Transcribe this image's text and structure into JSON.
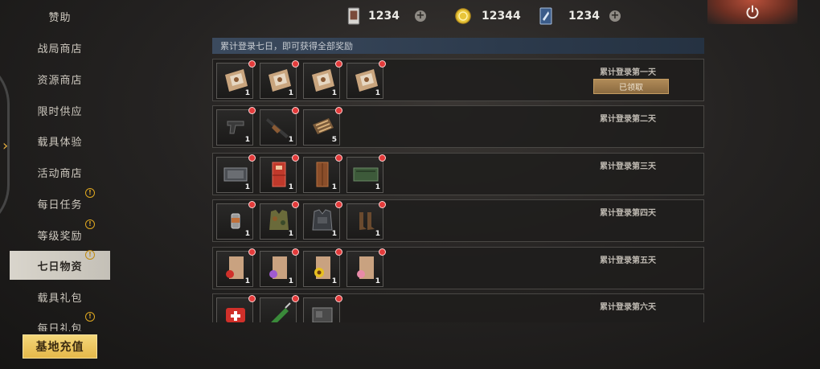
{
  "sidebar": {
    "items": [
      {
        "label": "赞助",
        "badge": false,
        "active": false
      },
      {
        "label": "战局商店",
        "badge": false,
        "active": false
      },
      {
        "label": "资源商店",
        "badge": false,
        "active": false
      },
      {
        "label": "限时供应",
        "badge": false,
        "active": false
      },
      {
        "label": "载具体验",
        "badge": false,
        "active": false
      },
      {
        "label": "活动商店",
        "badge": false,
        "active": false
      },
      {
        "label": "每日任务",
        "badge": true,
        "active": false
      },
      {
        "label": "等级奖励",
        "badge": true,
        "active": false
      },
      {
        "label": "七日物资",
        "badge": true,
        "active": true
      },
      {
        "label": "载具礼包",
        "badge": false,
        "active": false
      },
      {
        "label": "每日礼包",
        "badge": true,
        "active": false
      }
    ],
    "badge_glyph": "!",
    "recharge_label": "基地充值"
  },
  "currency": {
    "card": {
      "value": "1234",
      "icon": "card-icon"
    },
    "coin": {
      "value": "12344",
      "icon": "coin-icon"
    },
    "ticket": {
      "value": "1234",
      "icon": "ticket-icon"
    },
    "plus_glyph": "+"
  },
  "banner_text": "累计登录七日，即可获得全部奖励",
  "claimed_label": "已领取",
  "rewards": [
    {
      "day_label": "累计登录第一天",
      "claimed": true,
      "items": [
        {
          "icon": "supply-bag",
          "count": "1"
        },
        {
          "icon": "supply-bag",
          "count": "1"
        },
        {
          "icon": "supply-bag",
          "count": "1"
        },
        {
          "icon": "supply-bag",
          "count": "1"
        }
      ]
    },
    {
      "day_label": "累计登录第二天",
      "claimed": false,
      "items": [
        {
          "icon": "pistol",
          "count": "1"
        },
        {
          "icon": "rifle",
          "count": "1"
        },
        {
          "icon": "ammo",
          "count": "5"
        }
      ]
    },
    {
      "day_label": "累计登录第三天",
      "claimed": false,
      "items": [
        {
          "icon": "crate-gray",
          "count": "1"
        },
        {
          "icon": "fridge-red",
          "count": "1"
        },
        {
          "icon": "cabinet",
          "count": "1"
        },
        {
          "icon": "crate-green",
          "count": "1"
        }
      ]
    },
    {
      "day_label": "累计登录第四天",
      "claimed": false,
      "items": [
        {
          "icon": "jar",
          "count": "1"
        },
        {
          "icon": "camo-vest",
          "count": "1"
        },
        {
          "icon": "armor-vest",
          "count": "1"
        },
        {
          "icon": "boots",
          "count": "1"
        }
      ]
    },
    {
      "day_label": "累计登录第五天",
      "claimed": false,
      "items": [
        {
          "icon": "seed-red",
          "count": "1"
        },
        {
          "icon": "seed-purple",
          "count": "1"
        },
        {
          "icon": "seed-sunflower",
          "count": "1"
        },
        {
          "icon": "seed-pink",
          "count": "1"
        }
      ]
    },
    {
      "day_label": "累计登录第六天",
      "claimed": false,
      "items": [
        {
          "icon": "medkit",
          "count": ""
        },
        {
          "icon": "syringe",
          "count": ""
        },
        {
          "icon": "machine-part",
          "count": ""
        }
      ]
    }
  ],
  "colors": {
    "accent": "#e5b84a",
    "active_tab": "#d9d5cc",
    "banner": "#3b4a5e",
    "badge": "#e33b3b"
  }
}
